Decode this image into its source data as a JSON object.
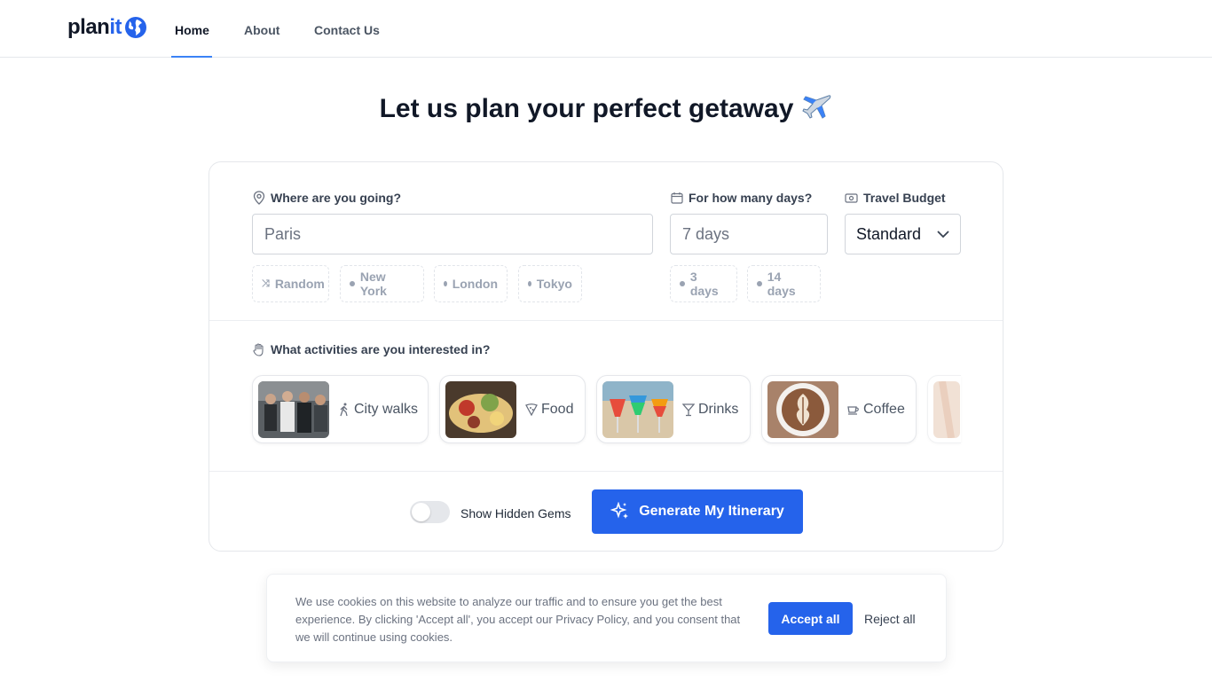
{
  "nav": {
    "logo_main": "plan",
    "logo_accent": "it",
    "links": [
      {
        "label": "Home",
        "active": true
      },
      {
        "label": "About",
        "active": false
      },
      {
        "label": "Contact Us",
        "active": false
      }
    ]
  },
  "hero": {
    "title": "Let us plan your perfect getaway"
  },
  "form": {
    "destination": {
      "label": "Where are you going?",
      "value": "Paris",
      "suggestions": [
        "Random",
        "New York",
        "London",
        "Tokyo"
      ]
    },
    "days": {
      "label": "For how many days?",
      "value": "7 days",
      "suggestions": [
        "3 days",
        "14 days"
      ]
    },
    "budget": {
      "label": "Travel Budget",
      "value": "Standard"
    },
    "activities": {
      "label": "What activities are you interested in?",
      "items": [
        {
          "label": "City walks",
          "icon": "walking-icon"
        },
        {
          "label": "Food",
          "icon": "pizza-icon"
        },
        {
          "label": "Drinks",
          "icon": "cocktail-icon"
        },
        {
          "label": "Coffee",
          "icon": "coffee-icon"
        }
      ]
    },
    "hidden_gems": {
      "label": "Show Hidden Gems",
      "enabled": false
    },
    "generate_label": "Generate My Itinerary"
  },
  "cookie": {
    "text": "We use cookies on this website to analyze our traffic and to ensure you get the best experience. By clicking 'Accept all', you accept our Privacy Policy, and you consent that we will continue using cookies.",
    "accept_label": "Accept all",
    "reject_label": "Reject all"
  },
  "colors": {
    "accent": "#2563eb",
    "text": "#111827",
    "muted": "#9aa3b2"
  }
}
